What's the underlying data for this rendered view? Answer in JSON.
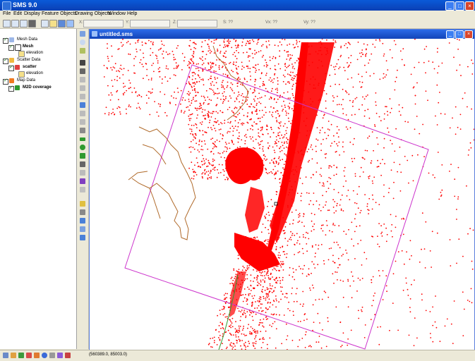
{
  "app": {
    "title": "SMS 9.0",
    "window_buttons": {
      "minimize": "_",
      "maximize": "□",
      "close": "×"
    }
  },
  "menu": [
    "File",
    "Edit",
    "Display",
    "Feature Objects",
    "Drawing Objects",
    "Window",
    "Help"
  ],
  "toolbar": {
    "coord_labels": [
      "X:",
      "Y:",
      "Z:",
      "S: ??",
      "Vx: ??",
      "Vy: ??"
    ]
  },
  "tree": [
    {
      "label": "Mesh Data"
    },
    {
      "label": "Mesh"
    },
    {
      "label": "elevation"
    },
    {
      "label": "Scatter Data"
    },
    {
      "label": "scatter"
    },
    {
      "label": "elevation"
    },
    {
      "label": "Map Data"
    },
    {
      "label": "M2D coverage"
    }
  ],
  "child_window": {
    "title": "untitled.sms",
    "buttons": {
      "minimize": "_",
      "maximize": "□",
      "close": "×"
    }
  },
  "status": {
    "coords": "(560389.0, 85003.0)"
  },
  "colors": {
    "mesh_nodes": "#ff0000",
    "coverage_box": "#cc33cc",
    "arcs": "#b06a2a",
    "green_arc": "#2f9a2f",
    "title_blue": "#0a5ad8"
  }
}
